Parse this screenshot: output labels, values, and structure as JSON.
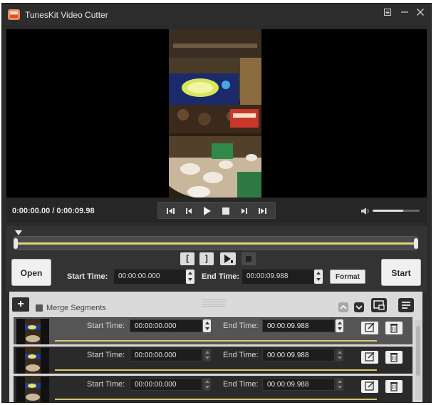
{
  "app": {
    "title": "TunesKit Video Cutter"
  },
  "window_controls": {
    "menu_icon": "menu-icon",
    "minimize_icon": "minimize-icon",
    "close_icon": "close-icon"
  },
  "player": {
    "timecode": "0:00:00.00 / 0:00:09.98",
    "volume": 0.65,
    "controls": [
      "previous-segment-icon",
      "step-back-icon",
      "play-icon",
      "stop-icon",
      "step-forward-icon",
      "next-segment-icon"
    ]
  },
  "cut": {
    "open_label": "Open",
    "start_label": "Start",
    "start_time_label": "Start Time:",
    "start_time_value": "00:00:00.000",
    "end_time_label": "End Time:",
    "end_time_value": "00:00:09.988",
    "format_label": "Format",
    "mark_in": "[",
    "mark_out": "]"
  },
  "segments_toolbar": {
    "add_label": "+",
    "merge_label": "Merge Segments",
    "merge_checked": false
  },
  "segments": [
    {
      "start_label": "Start Time:",
      "start": "00:00:00.000",
      "end_label": "End Time:",
      "end": "00:00:09.988",
      "selected": true
    },
    {
      "start_label": "Start Time:",
      "start": "00:00:00.000",
      "end_label": "End Time:",
      "end": "00:00:09.988",
      "selected": false
    },
    {
      "start_label": "Start Time:",
      "start": "00:00:00.000",
      "end_label": "End Time:",
      "end": "00:00:09.988",
      "selected": false
    }
  ],
  "colors": {
    "accent_track": "#e5d27a",
    "panel": "#2b2b2b",
    "segment_bg": "#dadada"
  }
}
